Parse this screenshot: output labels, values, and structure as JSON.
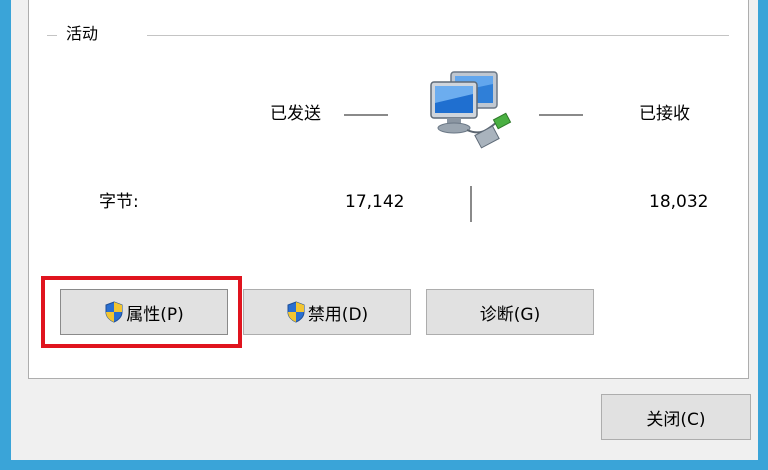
{
  "activity": {
    "group_title": "活动",
    "sent_label": "已发送",
    "received_label": "已接收",
    "bytes_label": "字节:",
    "bytes_sent": "17,142",
    "bytes_received": "18,032"
  },
  "buttons": {
    "properties": "属性(P)",
    "disable": "禁用(D)",
    "diagnose": "诊断(G)",
    "close": "关闭(C)"
  },
  "icons": {
    "network": "network-computer-icon",
    "shield": "uac-shield-icon"
  },
  "colors": {
    "window_border": "#3aa4d8",
    "highlight": "#e0141e",
    "button_face": "#e1e1e1"
  }
}
